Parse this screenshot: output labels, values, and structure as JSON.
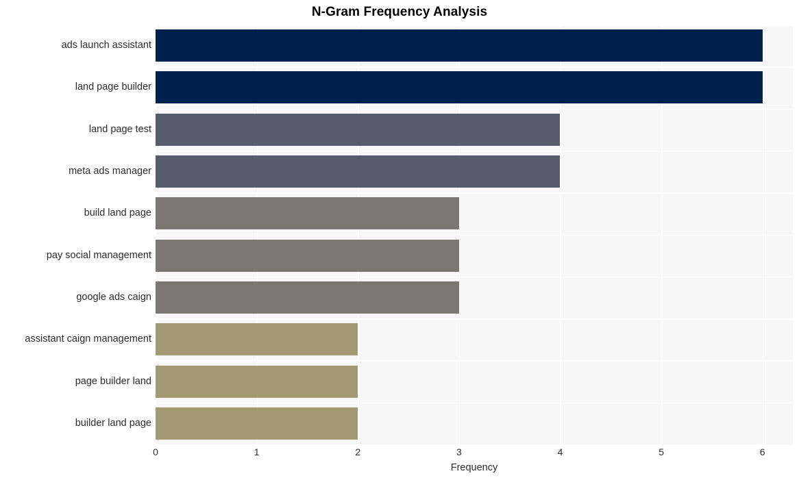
{
  "chart_data": {
    "type": "bar",
    "orientation": "horizontal",
    "title": "N-Gram Frequency Analysis",
    "xlabel": "Frequency",
    "ylabel": "",
    "categories": [
      "ads launch assistant",
      "land page builder",
      "land page test",
      "meta ads manager",
      "build land page",
      "pay social management",
      "google ads caign",
      "assistant caign management",
      "page builder land",
      "builder land page"
    ],
    "values": [
      6,
      6,
      4,
      4,
      3,
      3,
      3,
      2,
      2,
      2
    ],
    "xticks": [
      "0",
      "1",
      "2",
      "3",
      "4",
      "5",
      "6"
    ],
    "xtick_values": [
      0,
      1,
      2,
      3,
      4,
      5,
      6
    ],
    "xlim": [
      0,
      6.3
    ],
    "grid": true,
    "legend": "none",
    "bar_colors": [
      "#00214e",
      "#00214e",
      "#565b6e",
      "#565b6e",
      "#7b7874",
      "#7b7874",
      "#7b7874",
      "#a39a73",
      "#a39a73",
      "#a39a73"
    ],
    "plot_background": "#f7f7f8",
    "grid_color": "#ffffff",
    "figure_background": "#ffffff",
    "title_color": "#000000",
    "tick_label_color": "#2b2b2b"
  }
}
